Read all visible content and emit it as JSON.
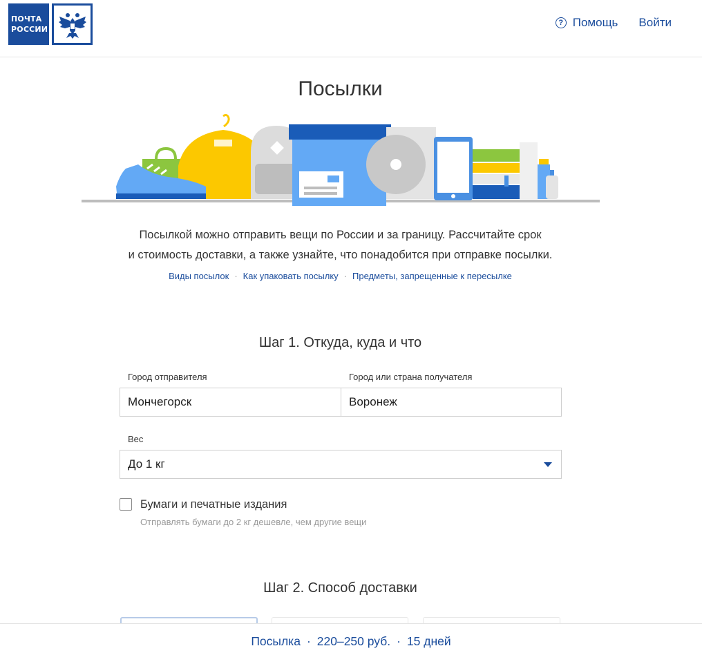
{
  "logo": {
    "line1": "ПОЧТА",
    "line2": "РОССИИ"
  },
  "nav": {
    "help": "Помощь",
    "login": "Войти"
  },
  "page_title": "Посылки",
  "intro": {
    "line1": "Посылкой можно отправить вещи по России и за границу. Рассчитайте срок",
    "line2": "и стоимость доставки, а также узнайте, что понадобится при отправке посылки."
  },
  "links": [
    "Виды посылок",
    "Как упаковать посылку",
    "Предметы, запрещенные к пересылке"
  ],
  "link_separator": "·",
  "step1": {
    "title": "Шаг 1. Откуда, куда и что",
    "from_label": "Город отправителя",
    "from_value": "Мончегорск",
    "to_label": "Город или страна получателя",
    "to_value": "Воронеж",
    "weight_label": "Вес",
    "weight_value": "До 1 кг",
    "papers_label": "Бумаги и печатные издания",
    "papers_hint": "Отправлять бумаги до 2 кг дешевле, чем другие вещи"
  },
  "step2": {
    "title": "Шаг 2. Способ доставки"
  },
  "summary": {
    "type": "Посылка",
    "price": "220–250 руб.",
    "duration": "15 дней",
    "separator": "·"
  },
  "colors": {
    "brand": "#1a4c9c",
    "box": "#63a9f5",
    "box_lid": "#1a5cb8",
    "yellow": "#fcc800",
    "green": "#8cc63f"
  }
}
